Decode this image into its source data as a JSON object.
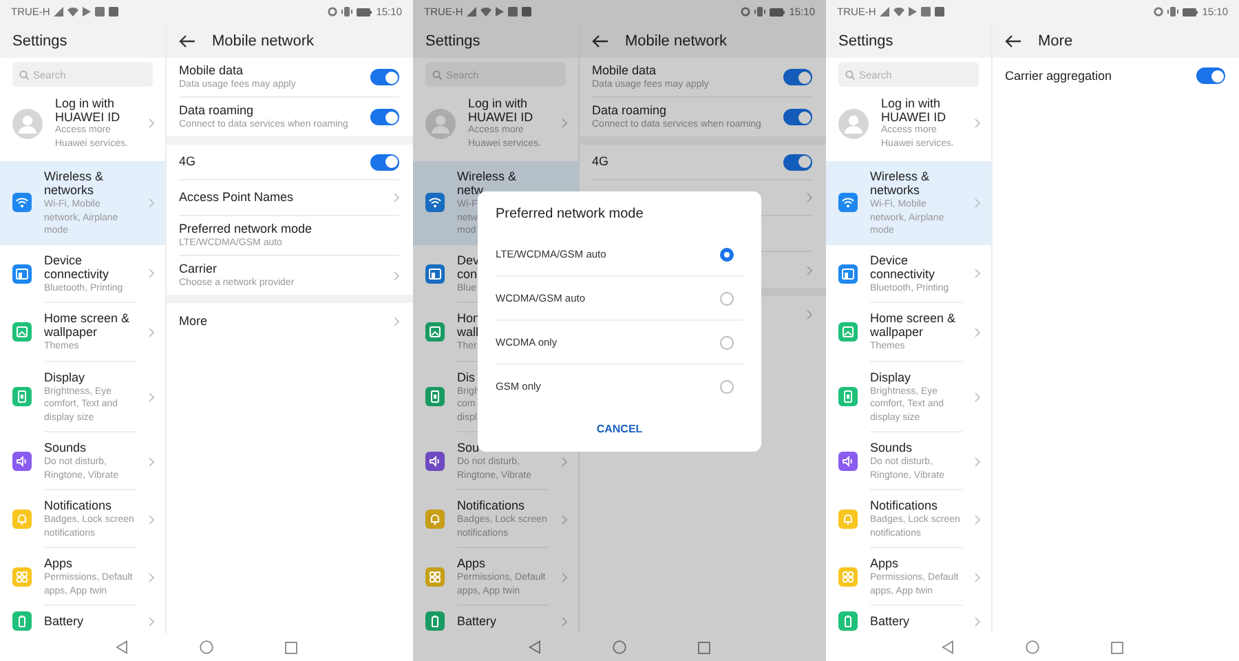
{
  "phones": [
    {
      "status_bar": {
        "carrier": "TRUE-H",
        "time": "15:10"
      },
      "sidebar": {
        "title": "Settings",
        "search": {
          "placeholder": "Search"
        },
        "account": {
          "title": "Log in with HUAWEI ID",
          "subtitle": "Access more Huawei services."
        },
        "items": [
          {
            "title": "Wireless & networks",
            "subtitle": "Wi-Fi, Mobile network, Airplane mode",
            "selected": true,
            "color": "#1e88f0"
          },
          {
            "title": "Device connectivity",
            "subtitle": "Bluetooth, Printing",
            "selected": false,
            "color": "#1e88f0"
          },
          {
            "title": "Home screen & wallpaper",
            "subtitle": "Themes",
            "selected": false,
            "color": "#1fc07a"
          },
          {
            "title": "Display",
            "subtitle": "Brightness, Eye comfort, Text and display size",
            "selected": false,
            "color": "#1fc07a"
          },
          {
            "title": "Sounds",
            "subtitle": "Do not disturb, Ringtone, Vibrate",
            "selected": false,
            "color": "#8a5cf0"
          },
          {
            "title": "Notifications",
            "subtitle": "Badges, Lock screen notifications",
            "selected": false,
            "color": "#f7c51e"
          },
          {
            "title": "Apps",
            "subtitle": "Permissions, Default apps, App twin",
            "selected": false,
            "color": "#f7c51e"
          },
          {
            "title": "Battery",
            "selected": false,
            "color": "#1fc07a"
          }
        ]
      },
      "detail": {
        "title": "Mobile network",
        "groups": [
          [
            {
              "kind": "toggle",
              "title": "Mobile data",
              "subtitle": "Data usage fees may apply",
              "on": true
            },
            {
              "kind": "toggle",
              "title": "Data roaming",
              "subtitle": "Connect to data services when roaming",
              "on": true
            }
          ],
          [
            {
              "kind": "toggle",
              "title": "4G",
              "on": true
            },
            {
              "kind": "link",
              "title": "Access Point Names"
            },
            {
              "kind": "value",
              "title": "Preferred network mode",
              "subtitle": "LTE/WCDMA/GSM auto"
            },
            {
              "kind": "link",
              "title": "Carrier",
              "subtitle": "Choose a network provider"
            }
          ],
          [
            {
              "kind": "link",
              "title": "More"
            }
          ]
        ]
      }
    },
    {
      "status_bar": {
        "carrier": "TRUE-H",
        "time": "15:10"
      },
      "sidebar": {
        "title": "Settings",
        "search": {
          "placeholder": "Search"
        },
        "account": {
          "title": "Log in with HUAWEI ID",
          "subtitle": "Access more Huawei services."
        },
        "items": [
          {
            "title": "Wireless &\nnetw",
            "subtitle": "Wi-F\nnetw\nmod",
            "selected": true,
            "color": "#186dc0"
          },
          {
            "title": "Dev\ncon",
            "subtitle": "Blue",
            "selected": false,
            "color": "#186dc0"
          },
          {
            "title": "Hon\nwall",
            "subtitle": "Ther",
            "selected": false,
            "color": "#199a62"
          },
          {
            "title": "Dis",
            "subtitle": "Brigh\ncom\ndispl",
            "selected": false,
            "color": "#199a62"
          },
          {
            "title": "Sou",
            "subtitle": "Do not disturb,\nRingtone, Vibrate",
            "selected": false,
            "color": "#6e4ac0"
          },
          {
            "title": "Notifications",
            "subtitle": "Badges, Lock screen notifications",
            "selected": false,
            "color": "#c69e18"
          },
          {
            "title": "Apps",
            "subtitle": "Permissions, Default apps, App twin",
            "selected": false,
            "color": "#c69e18"
          },
          {
            "title": "Battery",
            "selected": false,
            "color": "#199a62"
          }
        ]
      },
      "detail": {
        "title": "Mobile network",
        "groups": [
          [
            {
              "kind": "toggle",
              "title": "Mobile data",
              "subtitle": "Data usage fees may apply",
              "on": true
            },
            {
              "kind": "toggle",
              "title": "Data roaming",
              "subtitle": "Connect to data services when roaming",
              "on": true
            }
          ],
          [
            {
              "kind": "toggle",
              "title": "4G",
              "on": true
            },
            {
              "kind": "link"
            },
            {
              "kind": "value"
            },
            {
              "kind": "link"
            }
          ],
          [
            {
              "kind": "link"
            }
          ]
        ]
      },
      "dialog": {
        "title": "Preferred network mode",
        "options": [
          {
            "label": "LTE/WCDMA/GSM auto",
            "selected": true
          },
          {
            "label": "WCDMA/GSM auto",
            "selected": false
          },
          {
            "label": "WCDMA only",
            "selected": false
          },
          {
            "label": "GSM only",
            "selected": false
          }
        ],
        "cancel": "CANCEL"
      }
    },
    {
      "status_bar": {
        "carrier": "TRUE-H",
        "time": "15:10"
      },
      "sidebar": {
        "title": "Settings",
        "search": {
          "placeholder": "Search"
        },
        "account": {
          "title": "Log in with HUAWEI ID",
          "subtitle": "Access more Huawei services."
        },
        "items": [
          {
            "title": "Wireless & networks",
            "subtitle": "Wi-Fi, Mobile network, Airplane mode",
            "selected": true,
            "color": "#1e88f0"
          },
          {
            "title": "Device connectivity",
            "subtitle": "Bluetooth, Printing",
            "selected": false,
            "color": "#1e88f0"
          },
          {
            "title": "Home screen & wallpaper",
            "subtitle": "Themes",
            "selected": false,
            "color": "#1fc07a"
          },
          {
            "title": "Display",
            "subtitle": "Brightness, Eye comfort, Text and display size",
            "selected": false,
            "color": "#1fc07a"
          },
          {
            "title": "Sounds",
            "subtitle": "Do not disturb, Ringtone, Vibrate",
            "selected": false,
            "color": "#8a5cf0"
          },
          {
            "title": "Notifications",
            "subtitle": "Badges, Lock screen notifications",
            "selected": false,
            "color": "#f7c51e"
          },
          {
            "title": "Apps",
            "subtitle": "Permissions, Default apps, App twin",
            "selected": false,
            "color": "#f7c51e"
          },
          {
            "title": "Battery",
            "selected": false,
            "color": "#1fc07a"
          }
        ]
      },
      "detail": {
        "title": "More",
        "groups": [
          [
            {
              "kind": "toggle",
              "title": "Carrier aggregation",
              "on": true
            }
          ]
        ]
      }
    }
  ]
}
